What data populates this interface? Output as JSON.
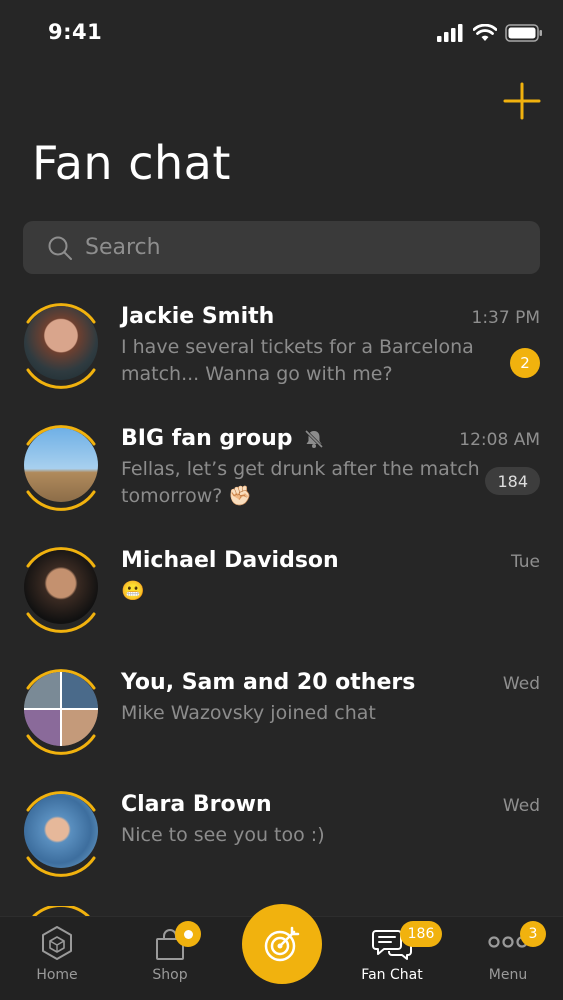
{
  "status_bar": {
    "time": "9:41"
  },
  "header": {
    "title": "Fan chat",
    "add_icon": "plus-icon"
  },
  "search": {
    "placeholder": "Search"
  },
  "chats": [
    {
      "name": "Jackie Smith",
      "time": "1:37 PM",
      "preview": "I have several tickets for a Barcelona match... Wanna go with me?",
      "unread": "2",
      "muted": false
    },
    {
      "name": "BIG fan group",
      "time": "12:08 AM",
      "preview": "Fellas, let’s get drunk after the match tomorrow? ✊🏻",
      "unread": "184",
      "muted": true
    },
    {
      "name": "Michael Davidson",
      "time": "Tue",
      "preview": "😬",
      "unread": "",
      "muted": false
    },
    {
      "name": "You, Sam and 20 others",
      "time": "Wed",
      "preview": "Mike Wazovsky joined chat",
      "unread": "",
      "muted": false
    },
    {
      "name": "Clara Brown",
      "time": "Wed",
      "preview": "Nice to see you too :)",
      "unread": "",
      "muted": false
    }
  ],
  "tab_bar": {
    "tabs": [
      {
        "label": "Home",
        "icon": "cube-icon",
        "badge": ""
      },
      {
        "label": "Shop",
        "icon": "shopping-bag-icon",
        "badge": ""
      },
      {
        "label": "Fan Chat",
        "icon": "chat-bubbles-icon",
        "badge": "186"
      },
      {
        "label": "Menu",
        "icon": "more-dots-icon",
        "badge": "3"
      }
    ],
    "center_icon": "target-dart-icon"
  },
  "colors": {
    "accent": "#F1B20E",
    "background": "#262626",
    "search_bg": "#3A3A3A"
  }
}
